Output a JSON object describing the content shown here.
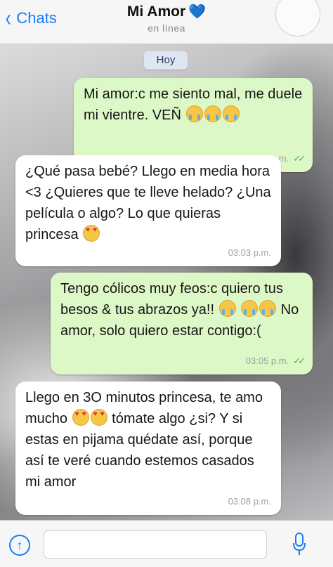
{
  "header": {
    "back_label": "Chats",
    "title": "Mi Amor",
    "heart": "💙",
    "status": "en línea"
  },
  "chat": {
    "day_label": "Hoy",
    "messages": [
      {
        "dir": "out",
        "text": "Mi amor:c me siento mal, me duele mi vientre. VEÑ",
        "time": "03:02 p.m."
      },
      {
        "dir": "in",
        "text": "¿Qué pasa bebé? Llego en media hora <3 ¿Quieres que te lleve helado? ¿Una película o algo? Lo que quieras princesa",
        "time": "03:03 p.m."
      },
      {
        "dir": "out",
        "text_a": "Tengo cólicos muy feos:c quiero tus besos & tus abrazos ya!!",
        "text_b": "No amor, solo quiero estar contigo:(",
        "time": "03:05 p.m."
      },
      {
        "dir": "in",
        "text_a": "Llego en 3O minutos princesa, te amo mucho",
        "text_b": "tómate algo ¿si? Y si estas en pijama quédate así, porque así te veré cuando estemos casados mi amor",
        "time": "03:08 p.m."
      }
    ]
  },
  "colors": {
    "accent": "#1a7cf5",
    "outgoing_bubble": "#dcf8c6",
    "incoming_bubble": "#ffffff",
    "read_ticks": "#4fb338"
  },
  "icons": [
    "chevron-left-icon",
    "heart-icon",
    "crying-face-icon",
    "heart-eyes-icon",
    "double-check-icon",
    "upload-icon",
    "microphone-icon"
  ]
}
